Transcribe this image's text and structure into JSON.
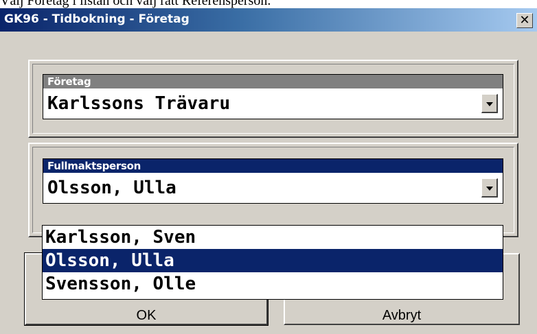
{
  "caption": "Välj Företag i listan och välj rätt Referensperson.",
  "window": {
    "title": "GK96 - Tidbokning - Företag"
  },
  "company_field": {
    "label": "Företag",
    "value": "Karlssons Trävaru",
    "label_color": "#808080"
  },
  "person_field": {
    "label": "Fullmaktsperson",
    "value": "Olsson, Ulla",
    "label_color": "#0a246a",
    "options": [
      {
        "label": "Karlsson, Sven",
        "selected": false
      },
      {
        "label": "Olsson, Ulla",
        "selected": true
      },
      {
        "label": "Svensson, Olle",
        "selected": false
      }
    ]
  },
  "buttons": {
    "ok": "OK",
    "cancel": "Avbryt"
  },
  "icons": {
    "close": "close-icon",
    "dropdown": "chevron-down-icon"
  }
}
